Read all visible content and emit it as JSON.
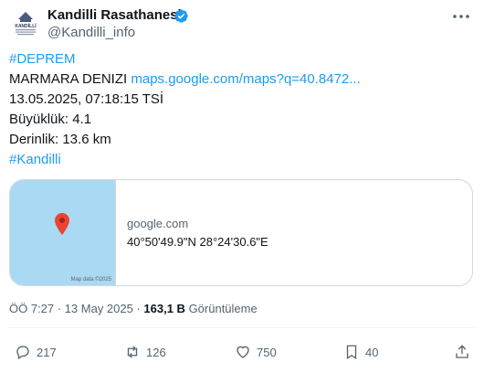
{
  "author": {
    "name": "Kandilli Rasathanesi",
    "handle": "@Kandilli_info",
    "avatar_text": "KANDİLLİ"
  },
  "tweet": {
    "lines": [
      {
        "text": "#DEPREM",
        "kind": "hashtag"
      },
      {
        "text": "MARMARA DENIZI ",
        "link": "maps.google.com/maps?q=40.8472..."
      },
      {
        "text": "13.05.2025, 07:18:15 TSİ"
      },
      {
        "text": "Büyüklük: 4.1"
      },
      {
        "text": "Derinlik: 13.6 km"
      },
      {
        "text": "#Kandilli",
        "kind": "hashtag"
      }
    ]
  },
  "card": {
    "domain": "google.com",
    "title": "40°50'49.9\"N 28°24'30.6\"E",
    "map_credit": "Map data ©2025"
  },
  "meta": {
    "time": "ÖÖ 7:27 · 13 May 2025 · ",
    "views_count": "163,1 B",
    "views_label": " Görüntüleme"
  },
  "actions": {
    "replies": "217",
    "reposts": "126",
    "likes": "750",
    "bookmarks": "40"
  },
  "colors": {
    "link": "#1d9bf0",
    "secondary": "#536471",
    "map_water": "#aadaf3",
    "pin": "#ea4335"
  }
}
